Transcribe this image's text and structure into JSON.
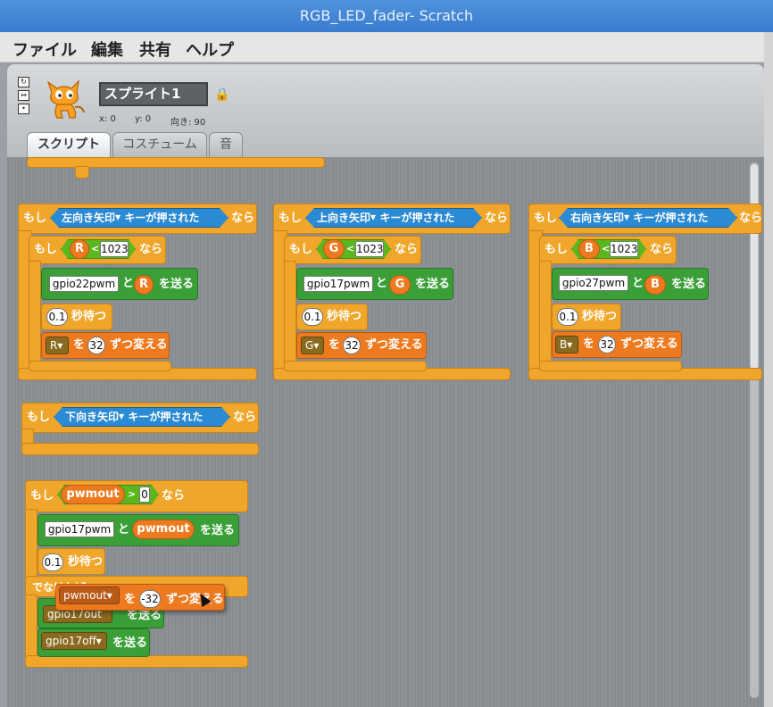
{
  "window": {
    "title": "RGB_LED_fader- Scratch"
  },
  "menu": {
    "file": "ファイル",
    "edit": "編集",
    "share": "共有",
    "help": "ヘルプ"
  },
  "sprite": {
    "name": "スプライト1",
    "x_label": "x: 0",
    "y_label": "y: 0",
    "direction_label": "向き: 90"
  },
  "tabs": {
    "scripts": "スクリプト",
    "costumes": "コスチューム",
    "sounds": "音"
  },
  "blocks": {
    "if": "もし",
    "then": "なら",
    "else": "でなければ",
    "key_pressed": "キーが押された",
    "and": "と",
    "send": "を送る",
    "wait": "秒待つ",
    "wo": "を",
    "change_by": "ずつ変える",
    "lt": "<",
    "gt": ">"
  },
  "scripts": {
    "left": {
      "key": "左向き矢印",
      "var": "R",
      "limit": "1023",
      "gpio": "gpio22pwm",
      "wait": "0.1",
      "step": "32"
    },
    "up": {
      "key": "上向き矢印",
      "var": "G",
      "limit": "1023",
      "gpio": "gpio17pwm",
      "wait": "0.1",
      "step": "32"
    },
    "right": {
      "key": "右向き矢印",
      "var": "B",
      "limit": "1023",
      "gpio": "gpio27pwm",
      "wait": "0.1",
      "step": "32"
    },
    "down": {
      "key": "下向き矢印"
    },
    "pwm": {
      "var": "pwmout",
      "threshold": "0",
      "gpio": "gpio17pwm",
      "wait": "0.1",
      "drag_var": "pwmout",
      "drag_step": "-32",
      "hidden_send": "gpio17out",
      "off": "gpio17off"
    }
  },
  "colors": {
    "control": "#f0a62b",
    "sensing": "#2b8ad4",
    "operator": "#5cb71f",
    "variable": "#ee7a1f"
  }
}
